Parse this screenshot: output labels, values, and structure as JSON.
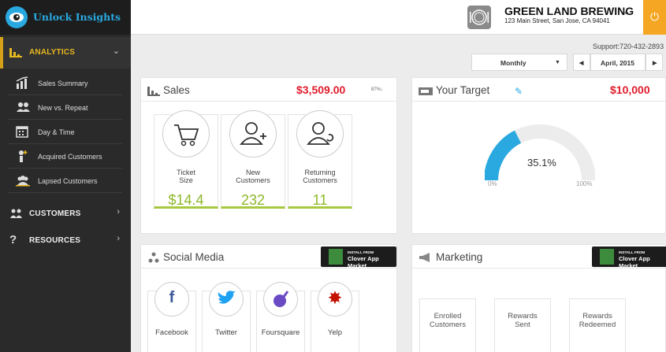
{
  "brand": {
    "name": "Unlock Insights"
  },
  "sidebar": {
    "analytics": {
      "label": "ANALYTICS"
    },
    "items": [
      {
        "label": "Sales Summary"
      },
      {
        "label": "New vs. Repeat"
      },
      {
        "label": "Day & Time"
      },
      {
        "label": "Acquired Customers"
      },
      {
        "label": "Lapsed Customers"
      }
    ],
    "customers": {
      "label": "CUSTOMERS"
    },
    "resources": {
      "label": "RESOURCES"
    }
  },
  "header": {
    "business": "GREEN LAND BREWING",
    "address": "123 Main Street, San Jose, CA 94041",
    "support": "Support:720-432-2893"
  },
  "controls": {
    "period": "Monthly",
    "date": "April, 2015"
  },
  "sales": {
    "title": "Sales",
    "amount": "$3,509.00",
    "change": "87%↓",
    "metrics": [
      {
        "label": "Ticket\nSize",
        "value": "$14.4"
      },
      {
        "label": "New\nCustomers",
        "value": "232"
      },
      {
        "label": "Returning\nCustomers",
        "value": "11"
      }
    ]
  },
  "target": {
    "title": "Your Target",
    "amount": "$10,000",
    "percent": "35.1%",
    "percent_value": 35.1,
    "min_label": "0%",
    "max_label": "100%"
  },
  "social": {
    "title": "Social Media",
    "items": [
      {
        "label": "Facebook"
      },
      {
        "label": "Twitter"
      },
      {
        "label": "Foursquare"
      },
      {
        "label": "Yelp"
      }
    ]
  },
  "marketing": {
    "title": "Marketing",
    "items": [
      {
        "label": "Enrolled\nCustomers"
      },
      {
        "label": "Rewards\nSent"
      },
      {
        "label": "Rewards\nRedeemed"
      }
    ]
  },
  "clover": {
    "line1": "INSTALL FROM",
    "line2": "Clover App Market"
  },
  "colors": {
    "accent": "#29a9e0",
    "money": "#e01b2b",
    "metric": "#8fb82b",
    "power": "#f5a623",
    "gold": "#e8b81f"
  }
}
